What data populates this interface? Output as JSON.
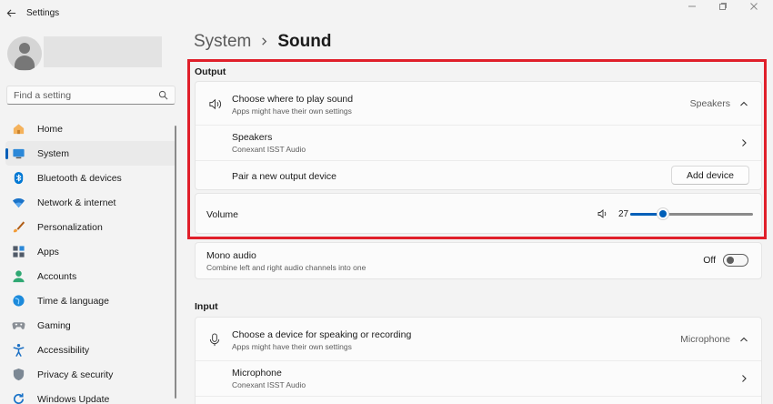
{
  "window": {
    "title": "Settings"
  },
  "sidebar": {
    "search_placeholder": "Find a setting",
    "items": [
      {
        "label": "Home",
        "icon": "home-icon"
      },
      {
        "label": "System",
        "icon": "system-icon",
        "active": true
      },
      {
        "label": "Bluetooth & devices",
        "icon": "bluetooth-icon"
      },
      {
        "label": "Network & internet",
        "icon": "wifi-icon"
      },
      {
        "label": "Personalization",
        "icon": "brush-icon"
      },
      {
        "label": "Apps",
        "icon": "apps-icon"
      },
      {
        "label": "Accounts",
        "icon": "accounts-icon"
      },
      {
        "label": "Time & language",
        "icon": "globe-icon"
      },
      {
        "label": "Gaming",
        "icon": "gamepad-icon"
      },
      {
        "label": "Accessibility",
        "icon": "accessibility-icon"
      },
      {
        "label": "Privacy & security",
        "icon": "shield-icon"
      },
      {
        "label": "Windows Update",
        "icon": "update-icon"
      }
    ]
  },
  "breadcrumb": {
    "parent": "System",
    "current": "Sound"
  },
  "output": {
    "section_label": "Output",
    "choose": {
      "title": "Choose where to play sound",
      "subtitle": "Apps might have their own settings",
      "value": "Speakers"
    },
    "speakers": {
      "title": "Speakers",
      "subtitle": "Conexant ISST Audio"
    },
    "pair": {
      "title": "Pair a new output device",
      "button": "Add device"
    },
    "volume": {
      "title": "Volume",
      "value": "27",
      "level": 0.27
    }
  },
  "mono": {
    "title": "Mono audio",
    "subtitle": "Combine left and right audio channels into one",
    "state": "Off"
  },
  "input": {
    "section_label": "Input",
    "choose": {
      "title": "Choose a device for speaking or recording",
      "subtitle": "Apps might have their own settings",
      "value": "Microphone"
    },
    "microphone": {
      "title": "Microphone",
      "subtitle": "Conexant ISST Audio"
    }
  },
  "colors": {
    "accent": "#005fb8",
    "highlight": "#e01f2a"
  }
}
